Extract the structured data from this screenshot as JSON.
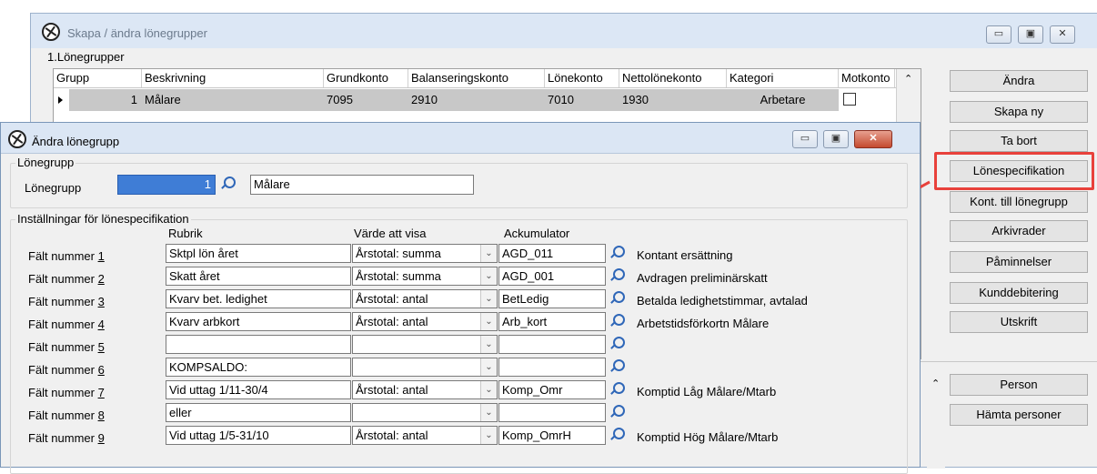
{
  "back_window": {
    "title": "Skapa / ändra lönegrupper",
    "group_label": "1.Lönegrupper",
    "columns": [
      "Grupp",
      "Beskrivning",
      "Grundkonto",
      "Balanseringskonto",
      "Lönekonto",
      "Nettolönekonto",
      "Kategori",
      "Motkonto"
    ],
    "rows": [
      {
        "grupp": "1",
        "beskrivning": "Målare",
        "grundkonto": "7095",
        "balanseringskonto": "2910",
        "lonekonto": "7010",
        "nettolonekonto": "1930",
        "kategori": "Arbetare"
      }
    ],
    "buttons": {
      "andra": "Ändra",
      "skapa_ny": "Skapa ny",
      "ta_bort": "Ta bort",
      "lonespecifikation": "Lönespecifikation",
      "kont_till_lonegrupp": "Kont. till lönegrupp",
      "arkivrader": "Arkivrader",
      "paminnelser": "Påminnelser",
      "kunddebitering": "Kunddebitering",
      "utskrift": "Utskrift",
      "person": "Person",
      "hamta_personer": "Hämta personer"
    },
    "highlight_color": "#e8413b"
  },
  "dialog": {
    "title": "Ändra lönegrupp",
    "lonegrupp_group": "Lönegrupp",
    "lonegrupp_label": "Lönegrupp",
    "lonegrupp_value": "1",
    "lonegrupp_name": "Målare",
    "settings_group": "Inställningar för lönespecifikation",
    "col_rubrik": "Rubrik",
    "col_varde": "Värde att visa",
    "col_ackumulator": "Ackumulator",
    "fields": [
      {
        "label": "Fält nummer 1",
        "rubrik": "Sktpl lön året",
        "varde": "Årstotal: summa",
        "ack": "AGD_011",
        "desc": "Kontant ersättning"
      },
      {
        "label": "Fält nummer 2",
        "rubrik": "Skatt året",
        "varde": "Årstotal: summa",
        "ack": "AGD_001",
        "desc": "Avdragen preliminärskatt"
      },
      {
        "label": "Fält nummer 3",
        "rubrik": "Kvarv bet. ledighet",
        "varde": "Årstotal: antal",
        "ack": "BetLedig",
        "desc": "Betalda ledighetstimmar, avtalad"
      },
      {
        "label": "Fält nummer 4",
        "rubrik": "Kvarv arbkort",
        "varde": "Årstotal: antal",
        "ack": "Arb_kort",
        "desc": "Arbetstidsförkortn Målare"
      },
      {
        "label": "Fält nummer 5",
        "rubrik": "",
        "varde": "",
        "ack": "",
        "desc": ""
      },
      {
        "label": "Fält nummer 6",
        "rubrik": "KOMPSALDO:",
        "varde": "",
        "ack": "",
        "desc": ""
      },
      {
        "label": "Fält nummer 7",
        "rubrik": "Vid uttag 1/11-30/4",
        "varde": "Årstotal: antal",
        "ack": "Komp_Omr",
        "desc": "Komptid Låg Målare/Mtarb"
      },
      {
        "label": "Fält nummer 8",
        "rubrik": "eller",
        "varde": "",
        "ack": "",
        "desc": ""
      },
      {
        "label": "Fält nummer 9",
        "rubrik": "Vid uttag 1/5-31/10",
        "varde": "Årstotal: antal",
        "ack": "Komp_OmrH",
        "desc": "Komptid Hög Målare/Mtarb"
      }
    ]
  }
}
